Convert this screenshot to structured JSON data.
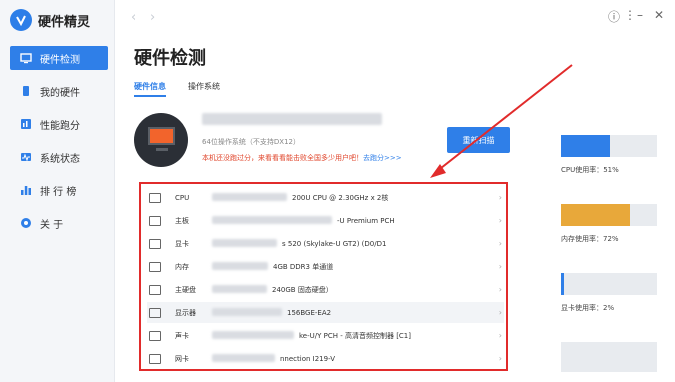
{
  "app": {
    "title": "硬件精灵"
  },
  "sidebar": {
    "items": [
      {
        "label": "硬件检测",
        "icon": "monitor-icon",
        "active": true
      },
      {
        "label": "我的硬件",
        "icon": "phone-icon"
      },
      {
        "label": "性能跑分",
        "icon": "chart-icon"
      },
      {
        "label": "系统状态",
        "icon": "status-icon"
      },
      {
        "label": "排 行 榜",
        "icon": "ranking-icon"
      },
      {
        "label": "关 于",
        "icon": "info-icon"
      }
    ]
  },
  "window": {
    "nav_back": "‹",
    "nav_forward": "›",
    "info": "ⓘ",
    "menu": "⋮",
    "minimize": "–",
    "close": "✕"
  },
  "main": {
    "title": "硬件检测",
    "tabs": [
      {
        "label": "硬件信息",
        "active": true
      },
      {
        "label": "操作系统"
      }
    ],
    "system": {
      "subtitle": "64位操作系统（不支持DX12）",
      "warning": "本机还没跑过分，来看看看能击败全国多少用户吧！",
      "warning_link": "去跑分>>>"
    },
    "scan_button": "重新扫描",
    "hardware": [
      {
        "label": "CPU",
        "value": "200U CPU @ 2.30GHz x 2核",
        "value_offset": 145
      },
      {
        "label": "主板",
        "value": "-U Premium PCH",
        "value_offset": 190
      },
      {
        "label": "显卡",
        "value": "s 520 (Skylake-U GT2) (D0/D1",
        "value_offset": 135
      },
      {
        "label": "内存",
        "value": "4GB DDR3 单通道",
        "value_offset": 126
      },
      {
        "label": "主硬盘",
        "value": "240GB 固态硬盘）",
        "value_offset": 125
      },
      {
        "label": "显示器",
        "value": "156BGE-EA2",
        "value_offset": 140
      },
      {
        "label": "声卡",
        "value": "ke-U/Y PCH - 高清音频控制器 [C1]",
        "value_offset": 152
      },
      {
        "label": "网卡",
        "value": "nnection I219-V",
        "value_offset": 133
      }
    ],
    "chevron": "›"
  },
  "usage": [
    {
      "label": "CPU使用率：51%",
      "percent": 51,
      "color": "#2f7fe8"
    },
    {
      "label": "内存使用率：72%",
      "percent": 72,
      "color": "#e8a83a"
    },
    {
      "label": "显卡使用率：2%",
      "percent": 2,
      "color": "#2f7fe8"
    }
  ]
}
